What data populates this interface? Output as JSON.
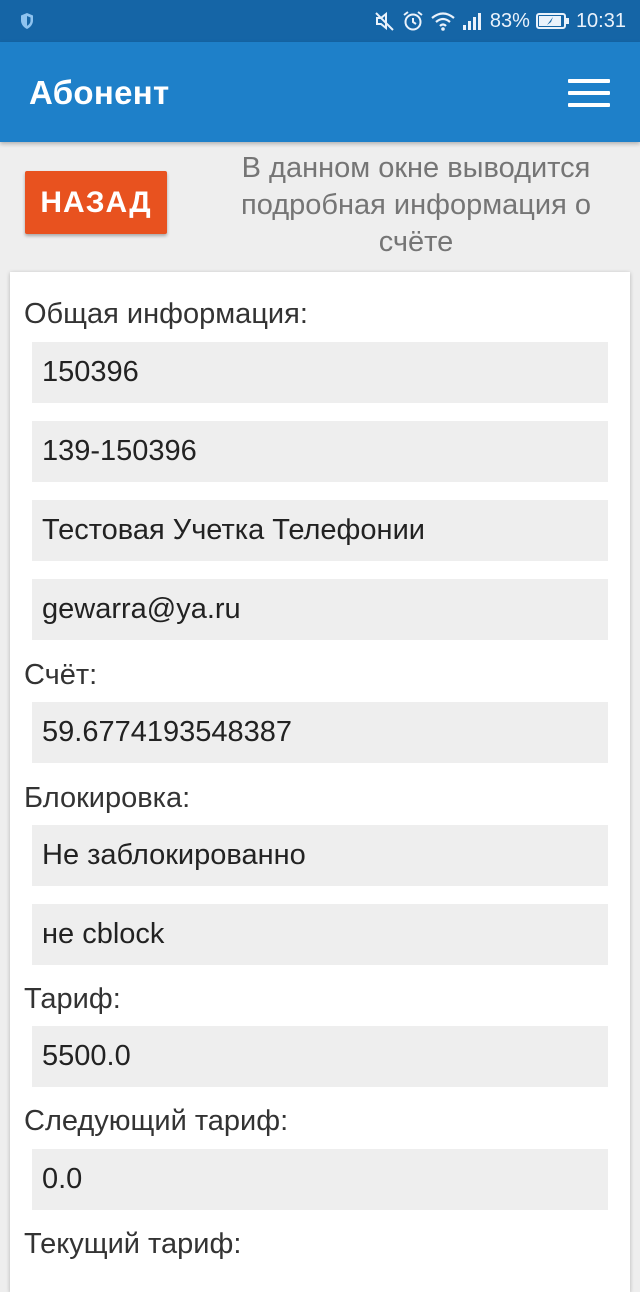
{
  "status_bar": {
    "battery": "83%",
    "time": "10:31",
    "icons": [
      "shield-icon",
      "mute-icon",
      "alarm-icon",
      "wifi-icon",
      "signal-icon",
      "battery-icon"
    ]
  },
  "app_bar": {
    "title": "Абонент",
    "menu_icon": "hamburger-menu-icon"
  },
  "header": {
    "back_label": "НАЗАД",
    "description": "В данном окне выводится подробная информация о счёте"
  },
  "sections": {
    "general": {
      "label": "Общая информация:",
      "values": [
        "150396",
        "139-150396",
        "Тестовая Учетка Телефонии",
        "gewarra@ya.ru"
      ]
    },
    "account": {
      "label": "Счёт:",
      "value": "59.6774193548387"
    },
    "block": {
      "label": "Блокировка:",
      "values": [
        "Не заблокированно",
        "не cblock"
      ]
    },
    "tariff": {
      "label": "Тариф:",
      "value": "5500.0"
    },
    "next_tariff": {
      "label": "Следующий тариф:",
      "value": "0.0"
    },
    "current_tariff": {
      "label": "Текущий тариф:"
    }
  },
  "colors": {
    "status_bar": "#1565a6",
    "app_bar": "#1e80c9",
    "back_button": "#e8521f",
    "field_background": "#eeeeee"
  }
}
